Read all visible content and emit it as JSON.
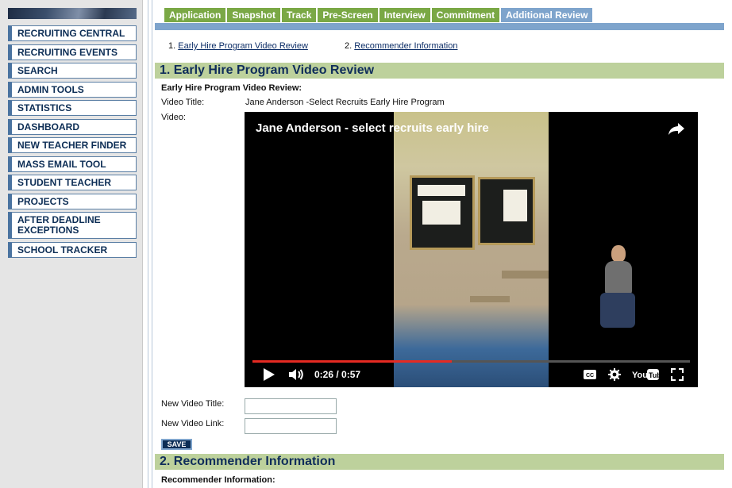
{
  "sidebar": {
    "items": [
      {
        "label": "RECRUITING CENTRAL"
      },
      {
        "label": "RECRUITING EVENTS"
      },
      {
        "label": "SEARCH"
      },
      {
        "label": "ADMIN TOOLS"
      },
      {
        "label": "STATISTICS"
      },
      {
        "label": "DASHBOARD"
      },
      {
        "label": "NEW TEACHER FINDER"
      },
      {
        "label": "MASS EMAIL TOOL"
      },
      {
        "label": "STUDENT TEACHER"
      },
      {
        "label": "PROJECTS"
      },
      {
        "label": "AFTER DEADLINE\nEXCEPTIONS"
      },
      {
        "label": "SCHOOL TRACKER"
      }
    ]
  },
  "tabs": [
    {
      "label": "Application"
    },
    {
      "label": "Snapshot"
    },
    {
      "label": "Track"
    },
    {
      "label": "Pre-Screen"
    },
    {
      "label": "Interview"
    },
    {
      "label": "Commitment"
    },
    {
      "label": "Additional Review",
      "active": true
    }
  ],
  "steps": [
    {
      "number": "1.",
      "label": "Early Hire Program Video Review"
    },
    {
      "number": "2.",
      "label": "Recommender Information"
    }
  ],
  "section1": {
    "header": "1. Early Hire Program Video Review",
    "subheading": "Early Hire Program Video Review:",
    "video_title_label": "Video Title:",
    "video_title_value": "Jane Anderson -Select Recruits Early Hire Program",
    "video_label": "Video:"
  },
  "video": {
    "title": "Jane Anderson - select recruits early hire",
    "current_time": "0:26",
    "duration": "0:57",
    "progress_fraction": 0.456,
    "colors": {
      "progress": "#e52a22"
    },
    "icons": [
      "share-icon",
      "play-icon",
      "volume-icon",
      "captions-icon",
      "settings-icon",
      "youtube-logo",
      "fullscreen-icon"
    ]
  },
  "form": {
    "new_video_title_label": "New Video Title:",
    "new_video_title_value": "",
    "new_video_link_label": "New Video Link:",
    "new_video_link_value": "",
    "save_label": "SAVE"
  },
  "section2": {
    "header": "2. Recommender Information",
    "subheading": "Recommender Information:"
  },
  "colors": {
    "tab_green": "#7aa845",
    "tab_active": "#7ea4cc",
    "section_header_bg": "#bdd19c",
    "nav_text": "#0c2d55"
  }
}
